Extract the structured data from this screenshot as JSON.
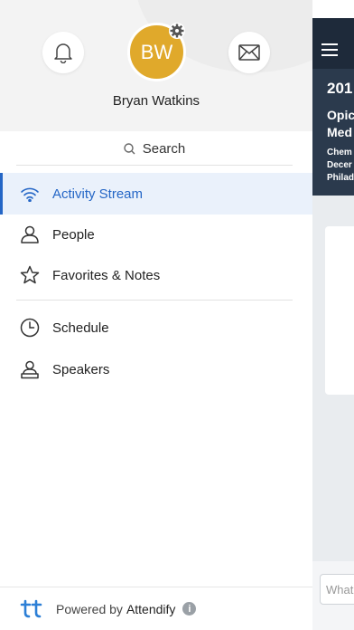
{
  "profile": {
    "initials": "BW",
    "name": "Bryan Watkins"
  },
  "search": {
    "label": "Search"
  },
  "menu": [
    {
      "label": "Activity Stream",
      "icon": "wifi-icon",
      "active": true
    },
    {
      "label": "People",
      "icon": "person-icon"
    },
    {
      "label": "Favorites & Notes",
      "icon": "star-icon"
    },
    {
      "label": "Schedule",
      "icon": "clock-icon"
    },
    {
      "label": "Speakers",
      "icon": "speaker-icon"
    }
  ],
  "footer": {
    "powered_by": "Powered by",
    "brand": "Attendify"
  },
  "background_screen": {
    "year": "201",
    "title_line1": "Opic",
    "title_line2": "Med",
    "sub_line1": "Chem",
    "sub_line2": "Decer",
    "sub_line3": "Philad",
    "input_placeholder": "What"
  },
  "colors": {
    "accent": "#2466c6",
    "avatar": "#e0a92b",
    "header_dark": "#1e2a3a"
  }
}
